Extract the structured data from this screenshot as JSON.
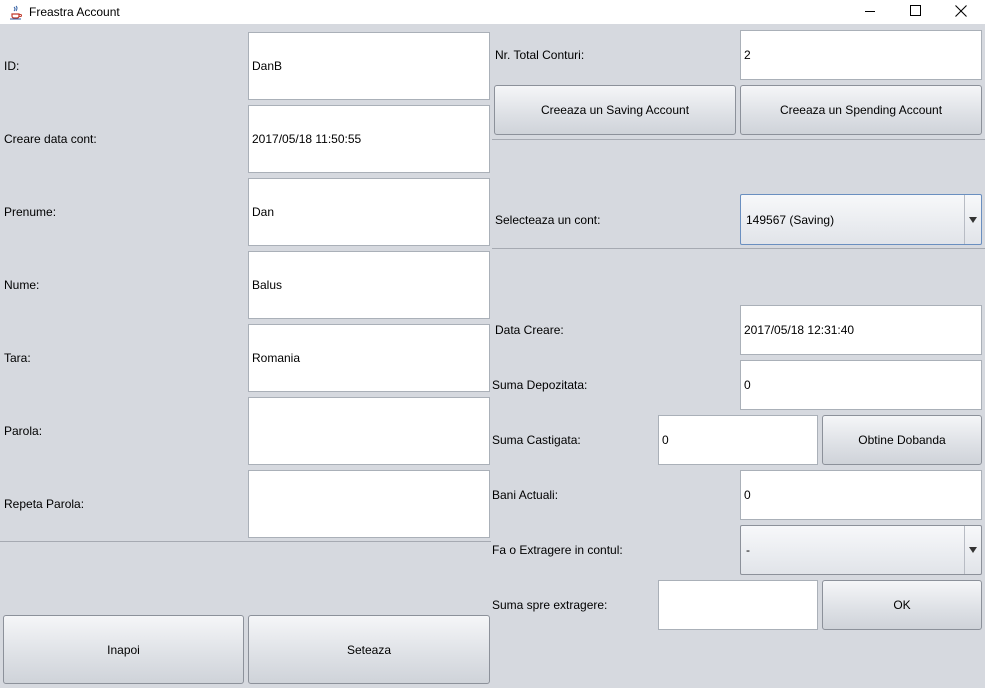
{
  "window": {
    "title": "Freastra Account",
    "minimize_icon": "minimize-icon",
    "maximize_icon": "maximize-icon",
    "close_icon": "close-icon"
  },
  "left": {
    "fields": [
      {
        "label": "ID:",
        "value": "DanB"
      },
      {
        "label": "Creare data cont:",
        "value": "2017/05/18 11:50:55"
      },
      {
        "label": "Prenume:",
        "value": "Dan"
      },
      {
        "label": "Nume:",
        "value": "Balus"
      },
      {
        "label": "Tara:",
        "value": "Romania"
      },
      {
        "label": "Parola:",
        "value": ""
      },
      {
        "label": "Repeta Parola:",
        "value": ""
      }
    ],
    "back_button": "Inapoi",
    "set_button": "Seteaza"
  },
  "right": {
    "total_label": "Nr. Total Conturi:",
    "total_value": "2",
    "create_saving_button": "Creeaza un Saving Account",
    "create_spending_button": "Creeaza un Spending Account",
    "select_label": "Selecteaza un cont:",
    "select_value": "149567 (Saving)",
    "created_label": "Data Creare:",
    "created_value": "2017/05/18 12:31:40",
    "deposit_label": "Suma Depozitata:",
    "deposit_value": "0",
    "earned_label": "Suma Castigata:",
    "earned_value": "0",
    "interest_button": "Obtine Dobanda",
    "current_label": "Bani Actuali:",
    "current_value": "0",
    "withdraw_account_label": "Fa o Extragere in contul:",
    "withdraw_account_value": "-",
    "withdraw_amount_label": "Suma spre extragere:",
    "withdraw_amount_value": "",
    "ok_button": "OK"
  }
}
